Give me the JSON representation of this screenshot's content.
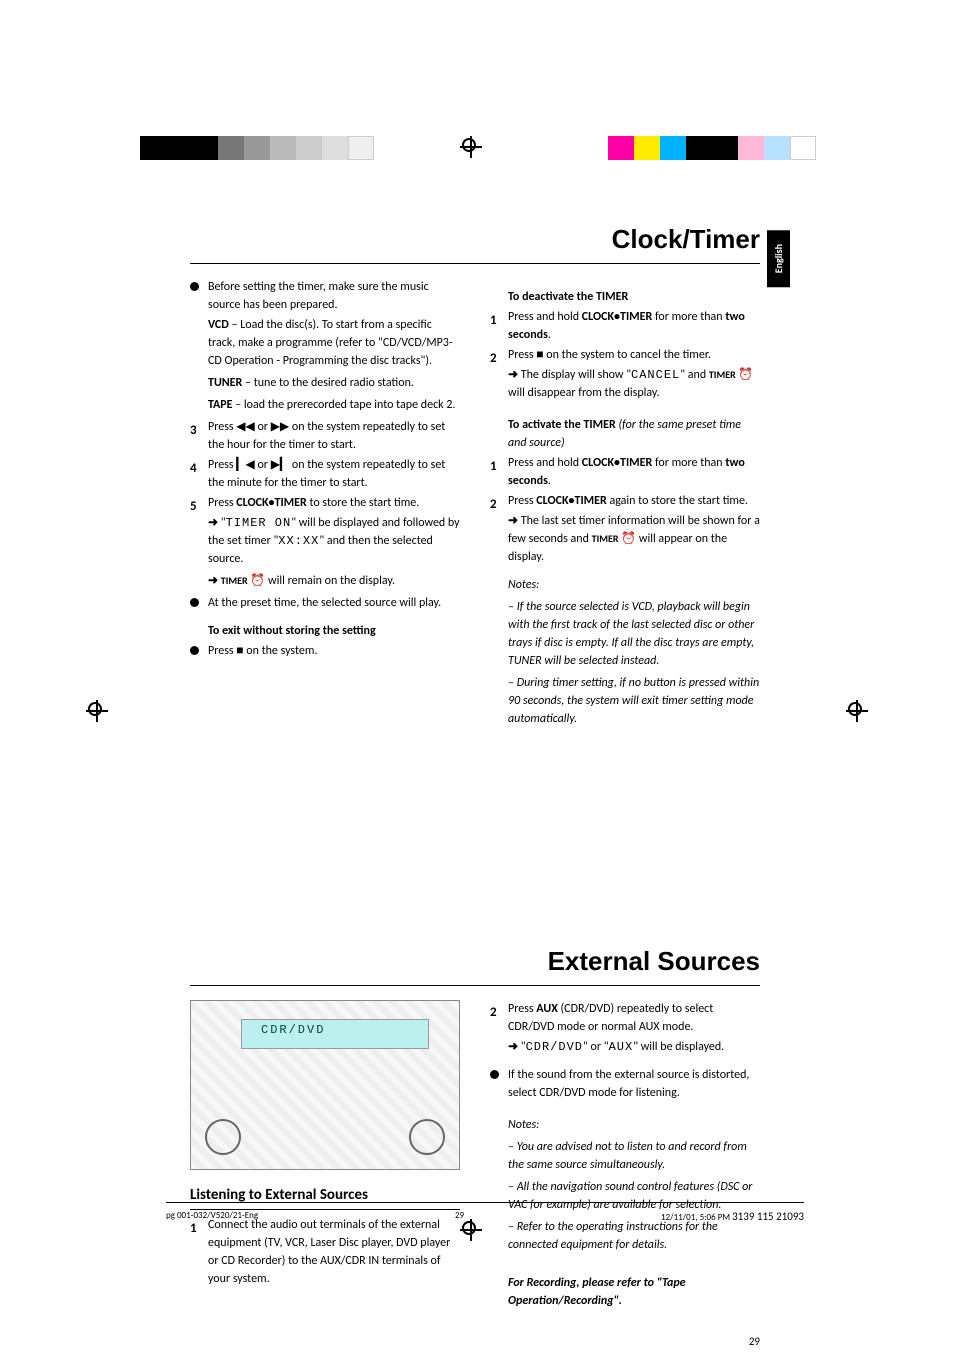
{
  "lang_tab": "English",
  "section1": {
    "title": "Clock/Timer",
    "left": {
      "intro_bullet": "Before setting the timer, make sure the music source has been prepared.",
      "vcd_label": "VCD",
      "vcd_text": " – Load the disc(s). To start from a specific track, make a programme (refer to \"CD/VCD/MP3-CD Operation - Programming the disc tracks\").",
      "tuner_label": "TUNER",
      "tuner_text": " – tune to the desired radio station.",
      "tape_label": "TAPE",
      "tape_text": " – load the prerecorded tape into tape deck 2.",
      "step3_a": "Press ",
      "step3_b": " or ",
      "step3_c": " on the system repeatedly to set the hour for the timer to start.",
      "step4_a": "Press ",
      "step4_b": " or ",
      "step4_c": " on the system repeatedly to set the minute for the timer to start.",
      "step5_a": "Press ",
      "step5_btn": "CLOCK•TIMER",
      "step5_b": " to store the start time.",
      "step5_arrow_a": "\"",
      "step5_disp": "TIMER ON",
      "step5_arrow_b": "\" will be displayed and followed by the set timer \"",
      "step5_disp2": "XX:XX",
      "step5_arrow_c": "\" and then the selected source.",
      "step5_remain_a": "TIMER",
      "step5_remain_b": " ⏰ will remain on the display.",
      "preset_bullet": "At the preset time, the selected source will play.",
      "exit_head": "To exit without storing the setting",
      "exit_bullet": "Press ■ on the system."
    },
    "right": {
      "deact_head": "To deactivate the TIMER",
      "deact_1a": "Press and hold ",
      "deact_1btn": "CLOCK•TIMER",
      "deact_1b": " for more than ",
      "deact_1c": "two seconds",
      "deact_1d": ".",
      "deact_2a": "Press ■ on the system to cancel the timer.",
      "deact_2arrow_a": "The display will show \"",
      "deact_2disp": "CANCEL",
      "deact_2arrow_b": "\" and ",
      "deact_2arrow_c": "TIMER",
      "deact_2arrow_d": " ⏰ will disappear from the display.",
      "act_head_a": "To activate the TIMER ",
      "act_head_b": "(for the same preset time and source)",
      "act_1a": "Press and hold ",
      "act_1btn": "CLOCK•TIMER",
      "act_1b": " for more than ",
      "act_1c": "two seconds",
      "act_1d": ".",
      "act_2a": "Press ",
      "act_2btn": "CLOCK•TIMER",
      "act_2b": " again to store the start time.",
      "act_2arrow_a": "The last set timer information will be shown for a few seconds and ",
      "act_2arrow_b": "TIMER",
      "act_2arrow_c": " ⏰ will appear on the display.",
      "notes_head": "Notes:",
      "note1": "–   If the source selected is VCD, playback will begin with the first track of the last selected disc or other trays if disc is empty. If all the disc trays are empty, TUNER will be selected instead.",
      "note2": "–   During timer setting, if no button is pressed within 90 seconds, the system will exit timer setting mode automatically."
    }
  },
  "section2": {
    "title": "External Sources",
    "illus_text": "CDR/DVD",
    "listening_head": "Listening to External Sources",
    "left_step1": "Connect the audio out terminals of the external equipment (TV, VCR, Laser Disc player, DVD player or CD Recorder) to the AUX/CDR IN terminals of your system.",
    "right": {
      "step2_a": "Press ",
      "step2_btn": "AUX",
      "step2_b": " (CDR/DVD) repeatedly to select CDR/DVD mode or normal AUX mode.",
      "step2_arrow_a": "\"",
      "step2_disp1": "CDR/DVD",
      "step2_arrow_b": "\" or \"",
      "step2_disp2": "AUX",
      "step2_arrow_c": "\" will be displayed.",
      "bul_a": "If the sound from the external source is distorted, select CDR/DVD mode for listening.",
      "notes_head": "Notes:",
      "note1": "–   You are advised not to listen to and record from the same source simultaneously.",
      "note2": "–   All the navigation sound control features (DSC or VAC for example) are available for selection.",
      "note3": "–   Refer to the operating instructions for the connected equipment for details.",
      "rec_a": "For Recording, please refer to \"Tape Operation/Recording\"."
    },
    "page_number": "29"
  },
  "footer": {
    "left": "pg 001-032/V520/21-Eng",
    "mid": "29",
    "right_a": "12/11/01, 5:06 PM ",
    "right_b": "3139 115 21093"
  }
}
